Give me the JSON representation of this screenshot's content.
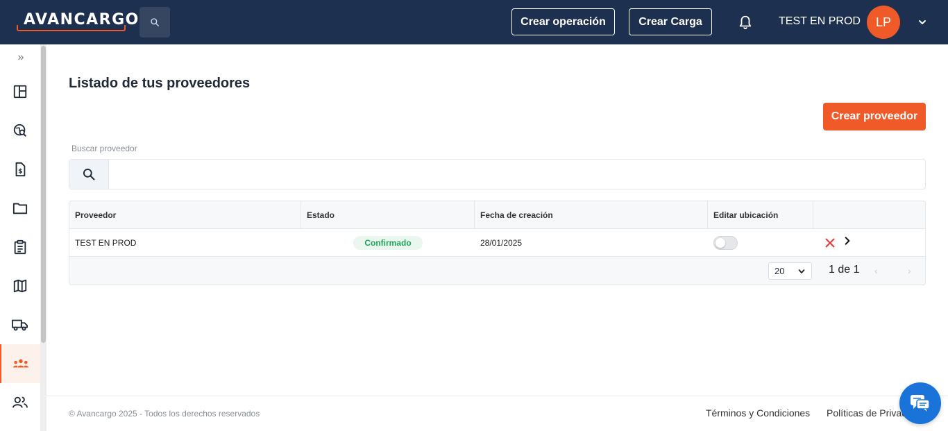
{
  "header": {
    "logo_text": "AVANCARGO",
    "create_operation_label": "Crear operación",
    "create_load_label": "Crear Carga",
    "username": "TEST EN PROD",
    "avatar_initials": "LP",
    "brand_color": "#f05a28",
    "header_bg": "#1e3050"
  },
  "sidebar": {
    "expand_icon": "»",
    "items": [
      {
        "name": "dashboard-icon"
      },
      {
        "name": "globe-search-icon"
      },
      {
        "name": "invoice-icon"
      },
      {
        "name": "folder-icon"
      },
      {
        "name": "clipboard-icon"
      },
      {
        "name": "map-icon"
      },
      {
        "name": "truck-icon"
      },
      {
        "name": "providers-icon",
        "active": true
      },
      {
        "name": "users-icon"
      }
    ]
  },
  "main": {
    "title": "Listado de tus proveedores",
    "create_button": "Crear proveedor",
    "search_label": "Buscar proveedor",
    "search_value": "",
    "table": {
      "columns": [
        "Proveedor",
        "Estado",
        "Fecha de creación",
        "Editar ubicación",
        ""
      ],
      "rows": [
        {
          "proveedor": "TEST EN PROD",
          "estado": "Confirmado",
          "fecha": "28/01/2025",
          "editar_ubicacion": false
        }
      ]
    },
    "pagination": {
      "page_size": "20",
      "page_info": "1 de 1",
      "prev_icon": "‹",
      "next_icon": "›"
    }
  },
  "footer": {
    "copyright": "© Avancargo 2025 - Todos los derechos reservados",
    "terms": "Términos y Condiciones",
    "privacy": "Políticas de Privacidad"
  }
}
